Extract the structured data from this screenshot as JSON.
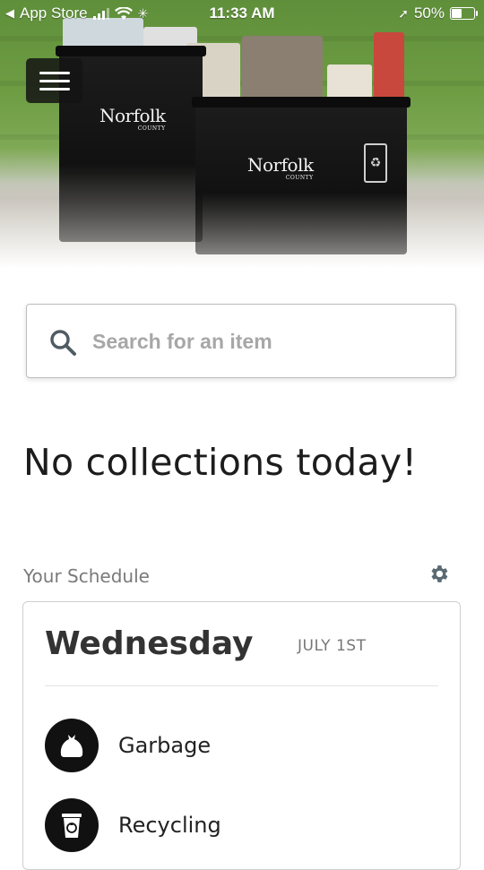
{
  "status_bar": {
    "back_app": "App Store",
    "time": "11:33 AM",
    "battery": "50%",
    "battery_level": 0.5
  },
  "hero": {
    "bin_brand": "Norfolk",
    "bin_brand_sub": "COUNTY"
  },
  "search": {
    "placeholder": "Search for an item"
  },
  "headline": "No collections today!",
  "schedule": {
    "label": "Your Schedule",
    "day": "Wednesday",
    "date": "JULY 1ST",
    "items": [
      {
        "label": "Garbage",
        "icon": "garbage-bag-icon"
      },
      {
        "label": "Recycling",
        "icon": "recycling-bin-icon"
      }
    ]
  },
  "colors": {
    "accent": "#5b6a72",
    "icon_bg": "#111111",
    "text_dark": "#1c1c1c",
    "placeholder": "#a7a7a7"
  }
}
